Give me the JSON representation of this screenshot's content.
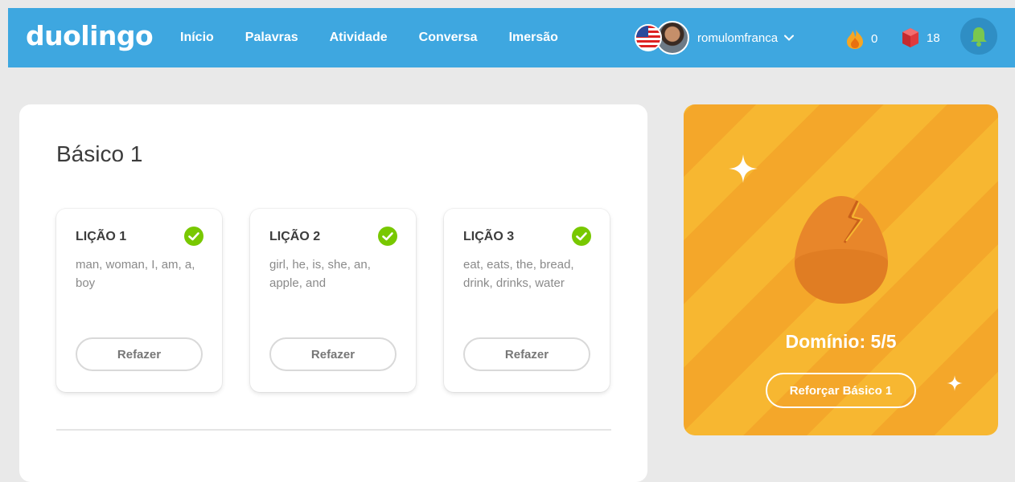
{
  "brand": {
    "logo": "duolingo"
  },
  "nav": {
    "items": [
      "Início",
      "Palavras",
      "Atividade",
      "Conversa",
      "Imersão"
    ]
  },
  "user": {
    "name": "romulomfranca",
    "streak": "0",
    "lingots": "18"
  },
  "skill": {
    "title": "Básico 1",
    "lessons": [
      {
        "title": "LIÇÃO 1",
        "words": "man, woman, I, am, a, boy",
        "button": "Refazer"
      },
      {
        "title": "LIÇÃO 2",
        "words": "girl, he, is, she, an, apple, and",
        "button": "Refazer"
      },
      {
        "title": "LIÇÃO 3",
        "words": "eat, eats, the, bread, drink, drinks, water",
        "button": "Refazer"
      }
    ]
  },
  "mastery": {
    "label": "Domínio: 5/5",
    "button": "Reforçar Básico 1"
  },
  "colors": {
    "topbar": "#3ea7e0",
    "check": "#78c800",
    "mastery": "#f7b731"
  },
  "icons": [
    "us-flag-icon",
    "chevron-down-icon",
    "flame-icon",
    "lingot-icon",
    "bell-icon",
    "check-icon",
    "egg-icon",
    "sparkle-icon"
  ]
}
